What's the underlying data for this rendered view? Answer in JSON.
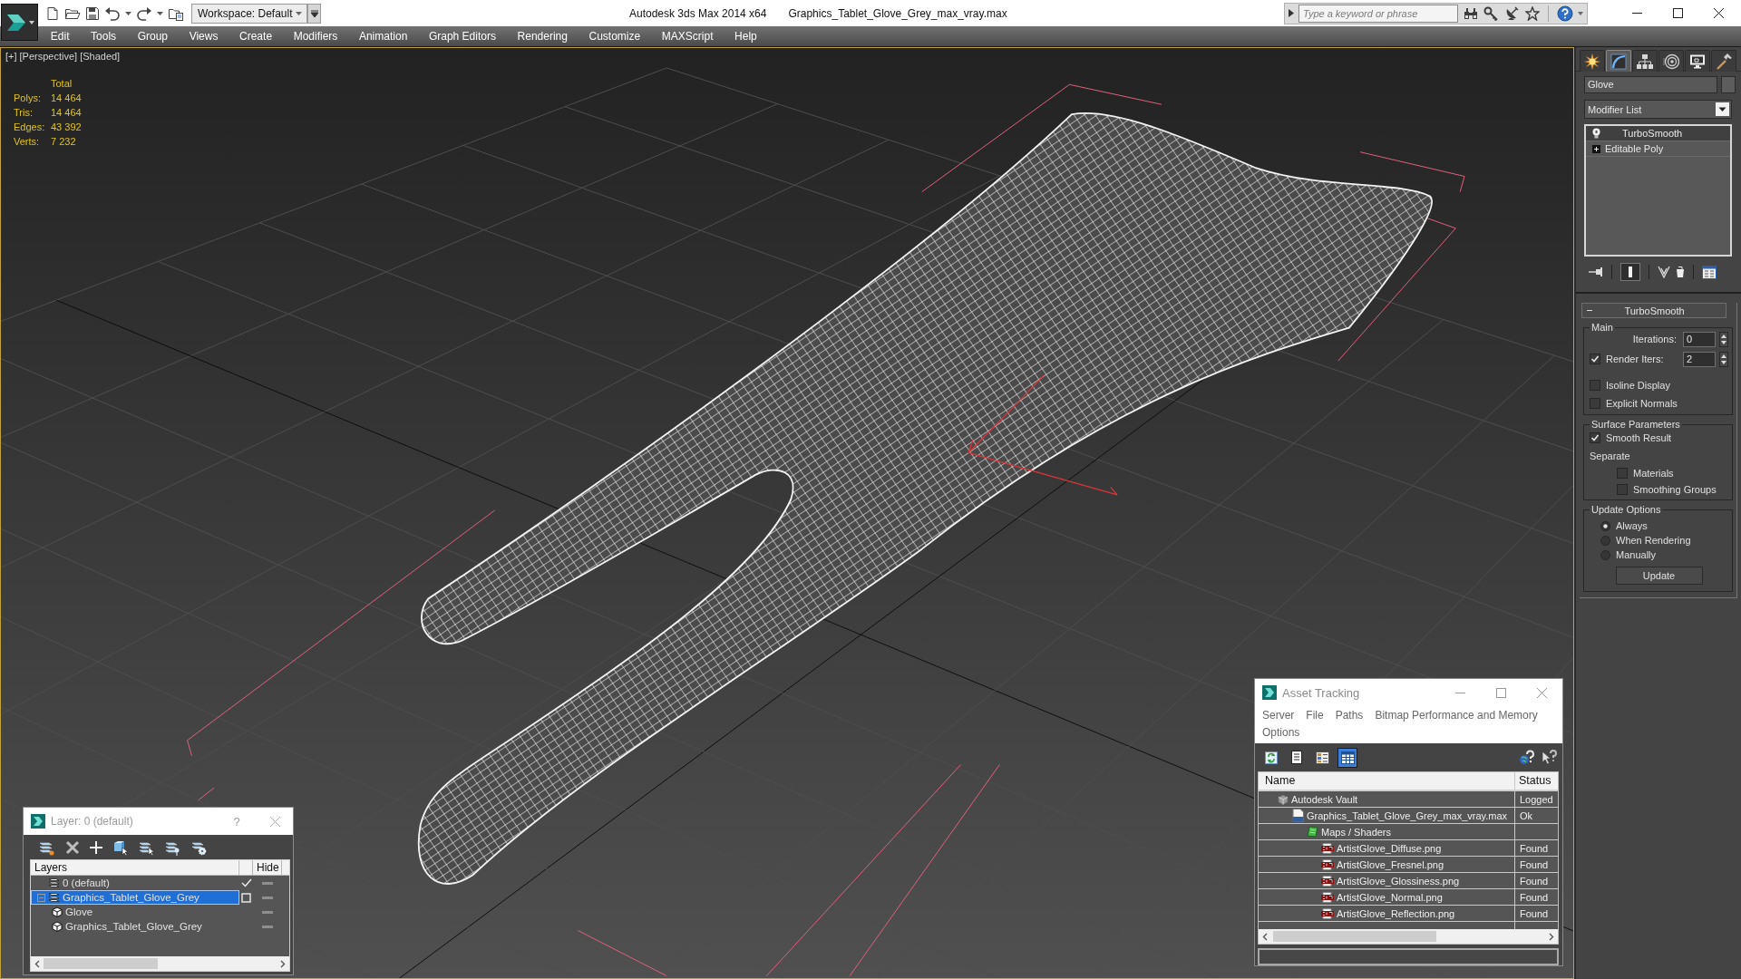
{
  "window": {
    "app_title": "Autodesk 3ds Max 2014 x64",
    "document_title": "Graphics_Tablet_Glove_Grey_max_vray.max"
  },
  "quick_access": {
    "workspace": "Workspace: Default"
  },
  "infocenter": {
    "placeholder": "Type a keyword or phrase"
  },
  "menu": [
    "Edit",
    "Tools",
    "Group",
    "Views",
    "Create",
    "Modifiers",
    "Animation",
    "Graph Editors",
    "Rendering",
    "Customize",
    "MAXScript",
    "Help"
  ],
  "viewport": {
    "active": true,
    "labels": [
      "[+]",
      "[Perspective]",
      "[Shaded]"
    ],
    "stats": {
      "heading": "Total",
      "rows": [
        {
          "label": "Polys:",
          "value": "14 464"
        },
        {
          "label": "Tris:",
          "value": "14 464"
        },
        {
          "label": "Edges:",
          "value": "43 392"
        },
        {
          "label": "Verts:",
          "value": "7 232"
        }
      ]
    }
  },
  "command_panel": {
    "tabs": [
      {
        "kind": "create",
        "selected": false
      },
      {
        "kind": "modify",
        "selected": true
      },
      {
        "kind": "hierarchy",
        "selected": false
      },
      {
        "kind": "motion",
        "selected": false
      },
      {
        "kind": "display",
        "selected": false
      },
      {
        "kind": "utilities",
        "selected": false
      }
    ],
    "object_name": "Glove",
    "modifier_list": "Modifier List",
    "stack": [
      {
        "kind": "modifier",
        "label": "TurboSmooth",
        "selected": true
      },
      {
        "kind": "base",
        "label": "Editable Poly",
        "selected": false
      }
    ],
    "rollout": {
      "title": "TurboSmooth",
      "expanded": true,
      "groups": [
        {
          "title": "Main",
          "controls": [
            {
              "kind": "spinner",
              "label": "Iterations:",
              "value": "0"
            },
            {
              "kind": "check-spinner",
              "label": "Render Iters:",
              "checked": true,
              "value": "2"
            },
            {
              "kind": "checkbox",
              "label": "Isoline Display",
              "checked": false
            },
            {
              "kind": "checkbox",
              "label": "Explicit Normals",
              "checked": false
            }
          ]
        },
        {
          "title": "Surface Parameters",
          "controls": [
            {
              "kind": "checkbox",
              "label": "Smooth Result",
              "checked": true
            },
            {
              "kind": "label",
              "label": "Separate",
              "children": [
                {
                  "kind": "checkbox",
                  "label": "Materials",
                  "checked": false
                },
                {
                  "kind": "checkbox",
                  "label": "Smoothing Groups",
                  "checked": false
                }
              ]
            }
          ]
        },
        {
          "title": "Update Options",
          "controls": [
            {
              "kind": "radio",
              "label": "Always",
              "selected": true
            },
            {
              "kind": "radio",
              "label": "When Rendering",
              "selected": false
            },
            {
              "kind": "radio",
              "label": "Manually",
              "selected": false
            },
            {
              "kind": "button",
              "label": "Update"
            }
          ]
        }
      ]
    }
  },
  "layer_dialog": {
    "title": "Layer: 0 (default)",
    "help_button": "?",
    "columns": [
      "Layers",
      "Hide"
    ],
    "layers": [
      {
        "name": "0 (default)",
        "current": true,
        "selected": false,
        "hidden": false
      },
      {
        "name": "Graphics_Tablet_Glove_Grey",
        "current": false,
        "selected": true,
        "hidden": false,
        "expanded": true,
        "children": [
          {
            "name": "Glove",
            "selected": false,
            "hidden": false
          },
          {
            "name": "Graphics_Tablet_Glove_Grey",
            "selected": false,
            "hidden": false
          }
        ]
      }
    ]
  },
  "asset_tracking": {
    "title": "Asset Tracking",
    "menu": [
      "Server",
      "File",
      "Paths",
      "Bitmap Performance and Memory",
      "Options"
    ],
    "toolbar": [
      {
        "kind": "refresh",
        "selected": false
      },
      {
        "kind": "list",
        "selected": false
      },
      {
        "kind": "thumbnails",
        "selected": false
      },
      {
        "kind": "table",
        "selected": true
      }
    ],
    "columns": [
      "Name",
      "Status"
    ],
    "assets": [
      {
        "kind": "vault",
        "name": "Autodesk Vault",
        "status": "Logged",
        "children": [
          {
            "kind": "max",
            "name": "Graphics_Tablet_Glove_Grey_max_vray.max",
            "status": "Ok",
            "children": [
              {
                "kind": "folder",
                "name": "Maps / Shaders",
                "children": [
                  {
                    "kind": "png",
                    "name": "ArtistGlove_Diffuse.png",
                    "status": "Found"
                  },
                  {
                    "kind": "png",
                    "name": "ArtistGlove_Fresnel.png",
                    "status": "Found"
                  },
                  {
                    "kind": "png",
                    "name": "ArtistGlove_Glossiness.png",
                    "status": "Found"
                  },
                  {
                    "kind": "png",
                    "name": "ArtistGlove_Normal.png",
                    "status": "Found"
                  },
                  {
                    "kind": "png",
                    "name": "ArtistGlove_Reflection.png",
                    "status": "Found"
                  }
                ]
              }
            ]
          }
        ]
      }
    ]
  }
}
